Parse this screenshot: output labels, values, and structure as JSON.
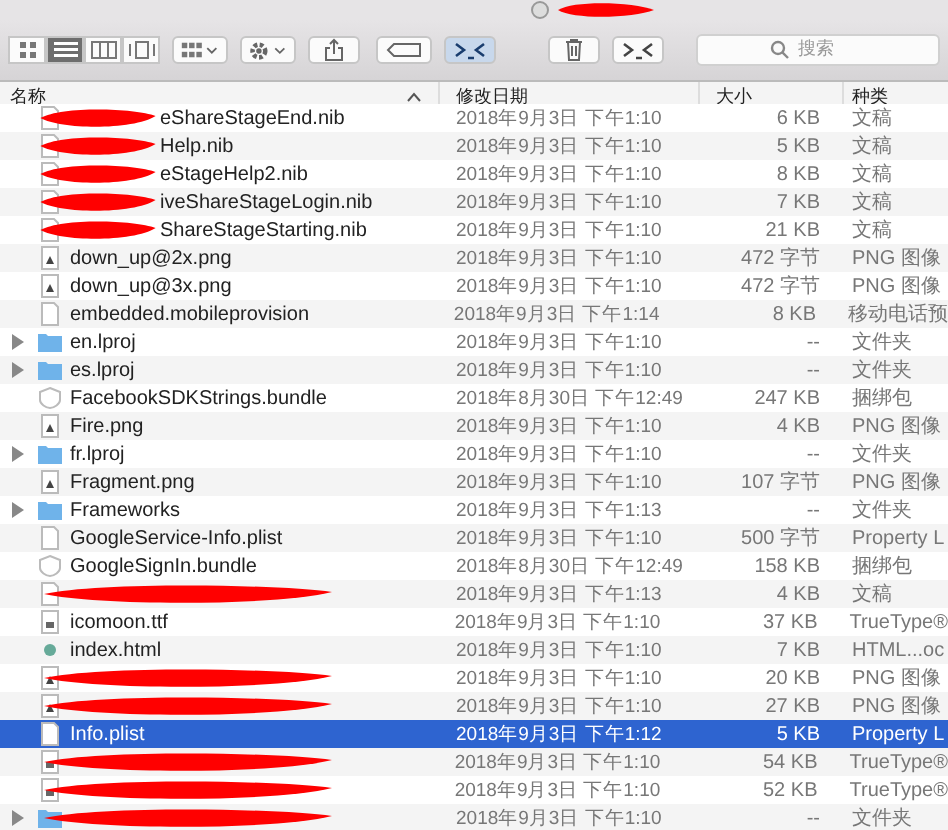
{
  "toolbar": {
    "view_modes": [
      {
        "kind": "icons",
        "selected": false
      },
      {
        "kind": "list",
        "selected": true
      },
      {
        "kind": "columns",
        "selected": false
      },
      {
        "kind": "gallery",
        "selected": false
      }
    ],
    "tools": [
      {
        "kind": "arrange",
        "selected": false
      },
      {
        "kind": "action",
        "selected": false
      },
      {
        "kind": "share",
        "selected": false
      },
      {
        "kind": "tag",
        "selected": false
      },
      {
        "kind": "terminal",
        "selected": true
      },
      {
        "kind": "trash",
        "selected": false
      },
      {
        "kind": "terminal",
        "selected": false
      }
    ],
    "search": {
      "placeholder": "搜索"
    }
  },
  "table": {
    "columns": [
      {
        "label": "名称",
        "sorted": true
      },
      {
        "label": "修改日期",
        "sorted": false
      },
      {
        "label": "大小",
        "sorted": false
      },
      {
        "label": "种类",
        "sorted": false
      }
    ],
    "rows": [
      {
        "kind": "document",
        "name": "eShareStageEnd.nib",
        "redacted": true,
        "selected": false,
        "date": "2018年9月3日 下午1:10",
        "size": "6 KB",
        "type": "文稿"
      },
      {
        "kind": "document",
        "name": "Help.nib",
        "redacted": true,
        "selected": false,
        "date": "2018年9月3日 下午1:10",
        "size": "5 KB",
        "type": "文稿"
      },
      {
        "kind": "document",
        "name": "eStageHelp2.nib",
        "redacted": true,
        "selected": false,
        "date": "2018年9月3日 下午1:10",
        "size": "8 KB",
        "type": "文稿"
      },
      {
        "kind": "document",
        "name": "iveShareStageLogin.nib",
        "redacted": true,
        "selected": false,
        "date": "2018年9月3日 下午1:10",
        "size": "7 KB",
        "type": "文稿"
      },
      {
        "kind": "document",
        "name": "ShareStageStarting.nib",
        "redacted": true,
        "selected": false,
        "date": "2018年9月3日 下午1:10",
        "size": "21 KB",
        "type": "文稿"
      },
      {
        "kind": "image",
        "name": "down_up@2x.png",
        "redacted": false,
        "selected": false,
        "date": "2018年9月3日 下午1:10",
        "size": "472 字节",
        "type": "PNG 图像"
      },
      {
        "kind": "image",
        "name": "down_up@3x.png",
        "redacted": false,
        "selected": false,
        "date": "2018年9月3日 下午1:10",
        "size": "472 字节",
        "type": "PNG 图像"
      },
      {
        "kind": "document",
        "name": "embedded.mobileprovision",
        "redacted": false,
        "selected": false,
        "date": "2018年9月3日 下午1:14",
        "size": "8 KB",
        "type": "移动电话预"
      },
      {
        "kind": "folder",
        "name": "en.lproj",
        "redacted": false,
        "selected": false,
        "date": "2018年9月3日 下午1:10",
        "size": "--",
        "type": "文件夹"
      },
      {
        "kind": "folder",
        "name": "es.lproj",
        "redacted": false,
        "selected": false,
        "date": "2018年9月3日 下午1:10",
        "size": "--",
        "type": "文件夹"
      },
      {
        "kind": "bundle",
        "name": "FacebookSDKStrings.bundle",
        "redacted": false,
        "selected": false,
        "date": "2018年8月30日 下午12:49",
        "size": "247 KB",
        "type": "捆绑包"
      },
      {
        "kind": "image",
        "name": "Fire.png",
        "redacted": false,
        "selected": false,
        "date": "2018年9月3日 下午1:10",
        "size": "4 KB",
        "type": "PNG 图像"
      },
      {
        "kind": "folder",
        "name": "fr.lproj",
        "redacted": false,
        "selected": false,
        "date": "2018年9月3日 下午1:10",
        "size": "--",
        "type": "文件夹"
      },
      {
        "kind": "image",
        "name": "Fragment.png",
        "redacted": false,
        "selected": false,
        "date": "2018年9月3日 下午1:10",
        "size": "107 字节",
        "type": "PNG 图像"
      },
      {
        "kind": "folder",
        "name": "Frameworks",
        "redacted": false,
        "selected": false,
        "date": "2018年9月3日 下午1:13",
        "size": "--",
        "type": "文件夹"
      },
      {
        "kind": "document",
        "name": "GoogleService-Info.plist",
        "redacted": false,
        "selected": false,
        "date": "2018年9月3日 下午1:10",
        "size": "500 字节",
        "type": "Property L"
      },
      {
        "kind": "bundle",
        "name": "GoogleSignIn.bundle",
        "redacted": false,
        "selected": false,
        "date": "2018年8月30日 下午12:49",
        "size": "158 KB",
        "type": "捆绑包"
      },
      {
        "kind": "document",
        "redacted": true,
        "selected": false,
        "date": "2018年9月3日 下午1:13",
        "size": "4 KB",
        "type": "文稿"
      },
      {
        "kind": "font",
        "name": "icomoon.ttf",
        "redacted": false,
        "selected": false,
        "date": "2018年9月3日 下午1:10",
        "size": "37 KB",
        "type": "TrueType®"
      },
      {
        "kind": "html",
        "name": "index.html",
        "redacted": false,
        "selected": false,
        "date": "2018年9月3日 下午1:10",
        "size": "7 KB",
        "type": "HTML...oc"
      },
      {
        "kind": "image",
        "redacted": true,
        "selected": false,
        "date": "2018年9月3日 下午1:10",
        "size": "20 KB",
        "type": "PNG 图像"
      },
      {
        "kind": "image",
        "redacted": true,
        "selected": false,
        "date": "2018年9月3日 下午1:10",
        "size": "27 KB",
        "type": "PNG 图像"
      },
      {
        "kind": "document",
        "name": "Info.plist",
        "redacted": false,
        "selected": true,
        "date": "2018年9月3日 下午1:12",
        "size": "5 KB",
        "type": "Property L"
      },
      {
        "kind": "font",
        "redacted": true,
        "selected": false,
        "date": "2018年9月3日 下午1:10",
        "size": "54 KB",
        "type": "TrueType®"
      },
      {
        "kind": "font",
        "redacted": true,
        "selected": false,
        "date": "2018年9月3日 下午1:10",
        "size": "52 KB",
        "type": "TrueType®"
      },
      {
        "kind": "folder",
        "redacted": true,
        "selected": false,
        "date": "2018年9月3日 下午1:10",
        "size": "--",
        "type": "文件夹"
      }
    ]
  }
}
